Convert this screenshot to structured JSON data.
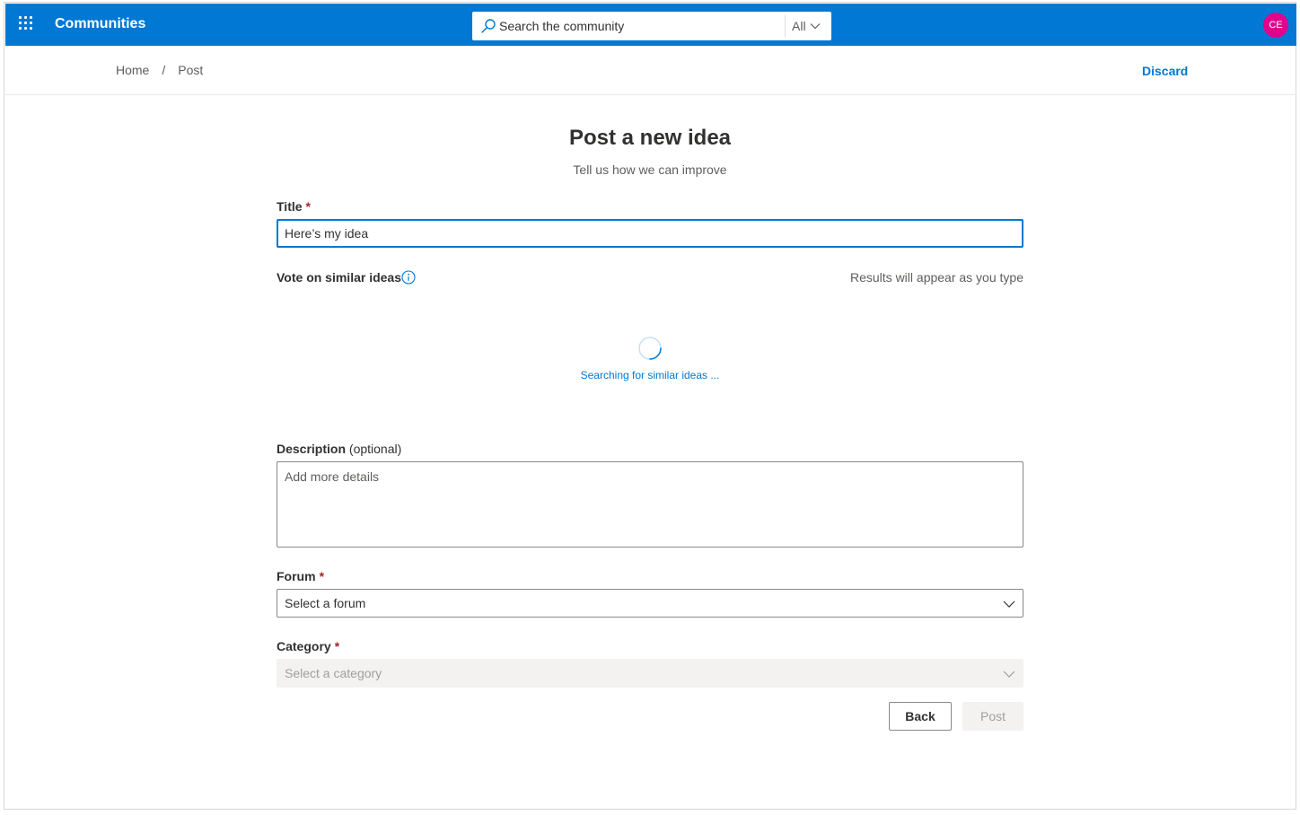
{
  "header": {
    "app_name": "Communities",
    "search": {
      "placeholder": "Search the community",
      "scope": "All"
    },
    "avatar_initials": "CE",
    "colors": {
      "primary": "#0078d4",
      "avatar": "#e3008c"
    }
  },
  "breadcrumb": {
    "items": [
      "Home",
      "Post"
    ],
    "separator": "/"
  },
  "actions": {
    "discard": "Discard"
  },
  "page": {
    "title": "Post a new idea",
    "subtitle": "Tell us how we can improve"
  },
  "form": {
    "title_field": {
      "label": "Title",
      "required_mark": "*",
      "value": "Here’s my idea"
    },
    "similar": {
      "label": "Vote on similar ideas",
      "hint": "Results will appear as you type",
      "status": "Searching for similar ideas ..."
    },
    "description": {
      "label": "Description",
      "optional": "(optional)",
      "placeholder": "Add more details"
    },
    "forum": {
      "label": "Forum",
      "required_mark": "*",
      "value": "Select a forum"
    },
    "category": {
      "label": "Category",
      "required_mark": "*",
      "value": "Select a category"
    },
    "buttons": {
      "back": "Back",
      "post": "Post"
    }
  }
}
